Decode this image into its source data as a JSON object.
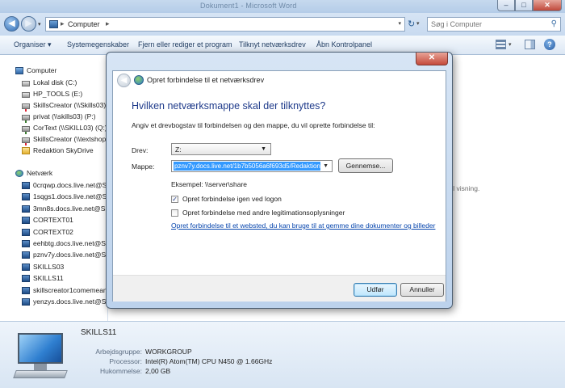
{
  "window": {
    "title": "Dokument1 - Microsoft Word",
    "minimize": "–",
    "maximize": "□",
    "close": "✕"
  },
  "address": {
    "back": "◀",
    "forward": "▶",
    "history_drop": "▾",
    "sep": "▸",
    "crumb": "Computer",
    "crumb_sep": "▸",
    "drop": "▾",
    "refresh": "↻",
    "refresh_drop": "▾",
    "search_placeholder": "Søg i Computer",
    "search_icon": "⚲"
  },
  "toolbar": {
    "organize": "Organiser ▾",
    "system_properties": "Systemegenskaber",
    "uninstall": "Fjern eller rediger et program",
    "map_drive": "Tilknyt netværksdrev",
    "control_panel": "Åbn Kontrolpanel",
    "view_drop": "▾",
    "help": "?"
  },
  "nav": {
    "computer": "Computer",
    "drives": [
      {
        "label": "Lokal disk (C:)",
        "icon": "disk"
      },
      {
        "label": "HP_TOOLS (E:)",
        "icon": "disk"
      },
      {
        "label": "SkillsCreator (\\\\Skills03) (O:)",
        "icon": "netdrive-x"
      },
      {
        "label": "privat (\\\\skills03) (P:)",
        "icon": "netdrive"
      },
      {
        "label": "CorText (\\\\SKILL03) (Q:)",
        "icon": "netdrive"
      },
      {
        "label": "SkillsCreator (\\\\textshop2\\…",
        "icon": "netdrive-x"
      },
      {
        "label": "Redaktion SkyDrive",
        "icon": "folder"
      }
    ],
    "network": "Netværk",
    "hosts": [
      "0crqwp.docs.live.net@SSL",
      "1sqgs1.docs.live.net@SSL",
      "3mn8s.docs.live.net@SSL",
      "CORTEXT01",
      "CORTEXT02",
      "eehbtg.docs.live.net@SSL",
      "pznv7y.docs.live.net@SSL",
      "SKILLS03",
      "SKILLS11",
      "skillscreator1comemeamt",
      "yenzys.docs.live.net@SSL"
    ]
  },
  "content": {
    "hint": "til visning."
  },
  "details": {
    "name": "SKILLS11",
    "rows": [
      {
        "label": "Arbejdsgruppe:",
        "value": "WORKGROUP"
      },
      {
        "label": "Processor:",
        "value": "Intel(R) Atom(TM) CPU N450  @ 1.66GHz"
      },
      {
        "label": "Hukommelse:",
        "value": "2,00 GB"
      }
    ]
  },
  "dialog": {
    "close": "✕",
    "back": "◀",
    "title": "Opret forbindelse til et netværksdrev",
    "heading": "Hvilken netværksmappe skal der tilknyttes?",
    "description": "Angiv et drevbogstav til forbindelsen og den mappe, du vil oprette forbindelse til:",
    "drive_label": "Drev:",
    "drive_value": "Z:",
    "drive_arrow": "▼",
    "folder_label": "Mappe:",
    "folder_value": "pznv7y.docs.live.net/1b7b5056a6f693d5/Redaktion",
    "folder_arrow": "▼",
    "browse": "Gennemse...",
    "example": "Eksempel: \\\\server\\share",
    "reconnect": {
      "label": "Opret forbindelse igen ved logon",
      "checked": true,
      "mark": "✓"
    },
    "other_credentials": {
      "label": "Opret forbindelse med andre legitimationsoplysninger",
      "checked": false,
      "mark": ""
    },
    "link": "Opret forbindelse til et websted, du kan bruge til at gemme dine dokumenter og billeder",
    "finish": "Udfør",
    "cancel": "Annuller"
  }
}
